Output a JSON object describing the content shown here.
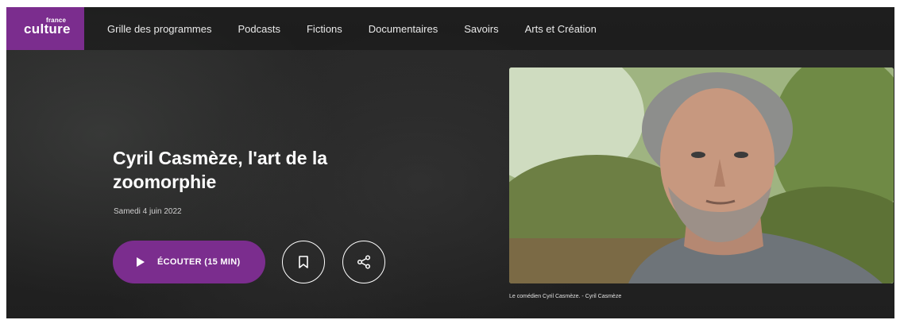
{
  "brand": {
    "small": "france",
    "main": "culture",
    "color": "#7b2d8e"
  },
  "nav": {
    "items": [
      {
        "label": "Grille des programmes"
      },
      {
        "label": "Podcasts"
      },
      {
        "label": "Fictions"
      },
      {
        "label": "Documentaires"
      },
      {
        "label": "Savoirs"
      },
      {
        "label": "Arts et Création"
      }
    ]
  },
  "episode": {
    "title": "Cyril Casmèze, l'art de la zoomorphie",
    "date": "Samedi 4 juin 2022",
    "listen_label": "ÉCOUTER (15 MIN)"
  },
  "actions": {
    "bookmark_icon": "bookmark-icon",
    "share_icon": "share-icon",
    "play_icon": "play-icon"
  },
  "image": {
    "caption": "Le comédien Cyril Casmèze. - Cyril Casmèze"
  }
}
